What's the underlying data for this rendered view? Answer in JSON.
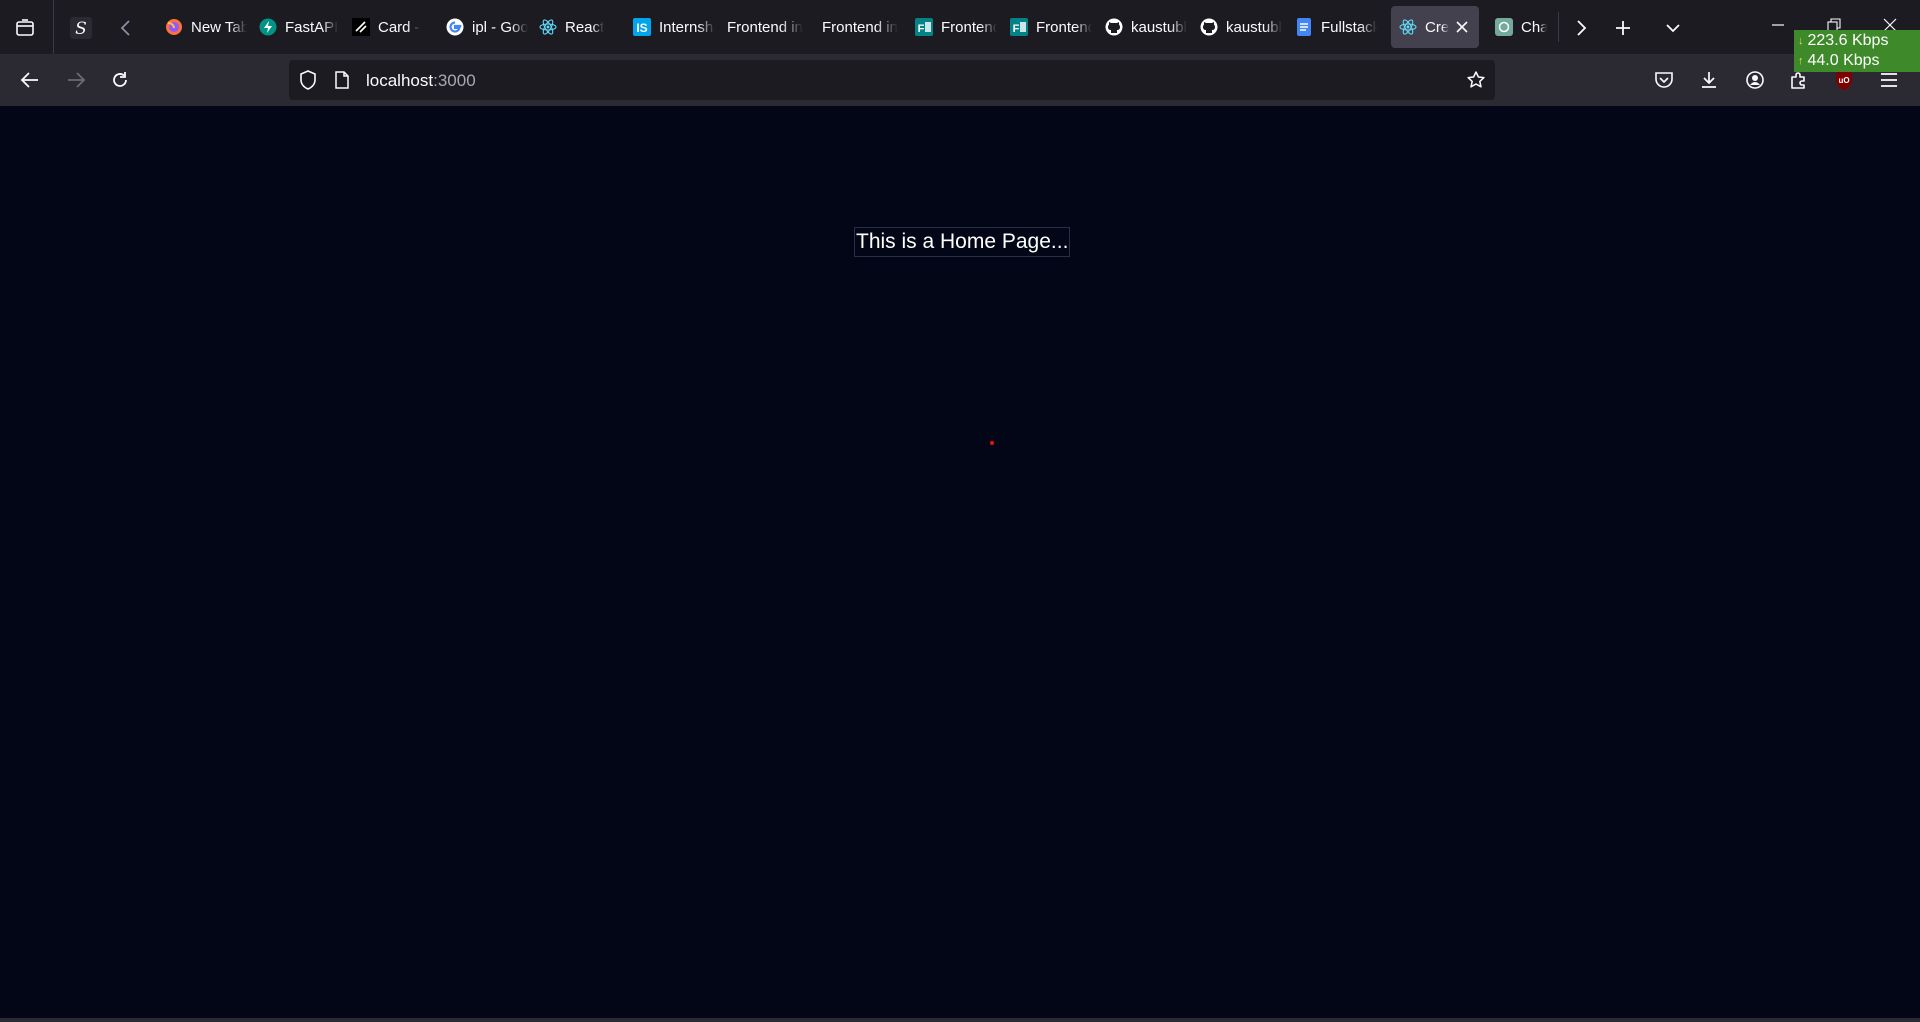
{
  "browser": {
    "tabs": [
      {
        "label": "New Tab",
        "favicon": "firefox-icon"
      },
      {
        "label": "FastAPI",
        "favicon": "fastapi-icon"
      },
      {
        "label": "Card -",
        "favicon": "shadcn-icon"
      },
      {
        "label": "ipl - Google",
        "favicon": "google-icon"
      },
      {
        "label": "React",
        "favicon": "react-icon"
      },
      {
        "label": "Internshala",
        "favicon": "internshala-icon"
      },
      {
        "label": "Frontend in",
        "favicon": "none"
      },
      {
        "label": "Frontend in",
        "favicon": "none"
      },
      {
        "label": "Frontend",
        "favicon": "forms-icon"
      },
      {
        "label": "Frontend",
        "favicon": "forms-icon"
      },
      {
        "label": "kaustubh",
        "favicon": "github-icon"
      },
      {
        "label": "kaustubh",
        "favicon": "github-icon"
      },
      {
        "label": "Fullstack",
        "favicon": "docs-icon"
      },
      {
        "label": "Cre",
        "favicon": "react-icon",
        "active": true
      },
      {
        "label": "ChatGPT",
        "favicon": "chatgpt-icon"
      }
    ],
    "url_host": "localhost",
    "url_port": ":3000",
    "net_meter": {
      "download": "223.6 Kbps",
      "upload": "44.0 Kbps"
    }
  },
  "page": {
    "home_text": "This is a Home Page...",
    "background": "#020617"
  },
  "colors": {
    "tab_strip": "#1c1b22",
    "toolbar": "#2b2a33",
    "active_tab": "#42414d",
    "net_meter_bg": "#3e8a2a",
    "cursor_dot": "#ee1111"
  }
}
